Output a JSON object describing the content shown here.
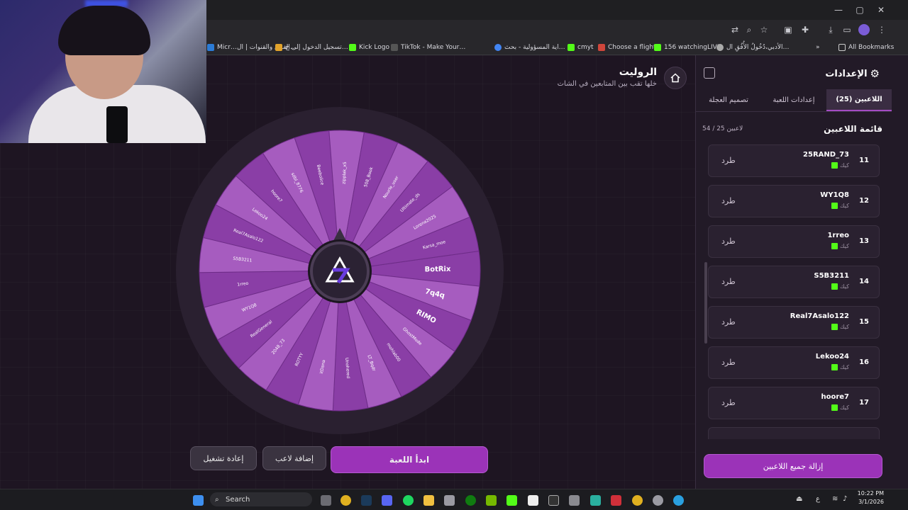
{
  "browser": {
    "bookmarks": [
      {
        "label": "Micr…",
        "color": "#2b7bd6"
      },
      {
        "label": "الفرق والقنوات | ال…",
        "color": "#c94cd9"
      },
      {
        "label": "تسجيل الدخول إلى ح…",
        "color": "#e2a32b"
      },
      {
        "label": "Kick Logo",
        "color": "#53fc18"
      },
      {
        "label": "TikTok - Make Your…",
        "color": "#ffffff"
      },
      {
        "label": "اية المسؤولية - بحث…",
        "color": "#4285f4"
      },
      {
        "label": "cmyt",
        "color": "#53fc18"
      },
      {
        "label": "Choose a flight",
        "color": "#d0463b"
      },
      {
        "label": "156 watchingLIVE",
        "color": "#53fc18"
      },
      {
        "label": "الأدبي،دُخُولُ الأُفُقِ ال…",
        "color": "#aaaaaa"
      }
    ],
    "all_bookmarks": "All Bookmarks",
    "window_controls": [
      "—",
      "▢",
      "✕"
    ]
  },
  "page": {
    "title": "الروليت",
    "subtitle": "خلها تقب بين المتابعين في الشات"
  },
  "wheel": {
    "colors": [
      "#8a3ea6",
      "#a65cbf"
    ],
    "segments": [
      "BotRix",
      "7q4q",
      "RIMO",
      "GhostMode",
      "mohlab00",
      "LT_Bqdr",
      "Unohered",
      "itDana",
      "ROTYY",
      "2048_73",
      "RealGeneral",
      "WY1Q8",
      "1rreo",
      "S5B3211",
      "Real7Asalo122",
      "Lekoo24",
      "hoore7",
      "sdbl_8776",
      "Beebolice",
      "zipplak_x5",
      "508_Book",
      "Nourle_user",
      "Ultimate_ds",
      "Lorena2025",
      "Karsa_moe"
    ]
  },
  "buttons": {
    "start": "ابدأ اللعبة",
    "add_player": "إضافة لاعب",
    "reset": "إعادة تشغيل",
    "remove_all": "إزالة جميع اللاعبين"
  },
  "panel": {
    "title": "الإعدادات",
    "tabs": [
      "اللاعبين (25)",
      "إعدادات اللعبة",
      "تصميم العجلة"
    ],
    "list_title": "قائمة اللاعبين",
    "count": "54 / 25 لاعبين",
    "kick_label": "طرد",
    "source_label": "كيك",
    "players": [
      {
        "num": "11",
        "name": "25RAND_73"
      },
      {
        "num": "12",
        "name": "WY1Q8"
      },
      {
        "num": "13",
        "name": "1rreo"
      },
      {
        "num": "14",
        "name": "S5B3211"
      },
      {
        "num": "15",
        "name": "Real7Asalo122"
      },
      {
        "num": "16",
        "name": "Lekoo24"
      },
      {
        "num": "17",
        "name": "hoore7"
      }
    ]
  },
  "taskbar": {
    "search": "Search",
    "time": "10:22 PM",
    "date": "3/1/2026",
    "lang": "ع"
  }
}
